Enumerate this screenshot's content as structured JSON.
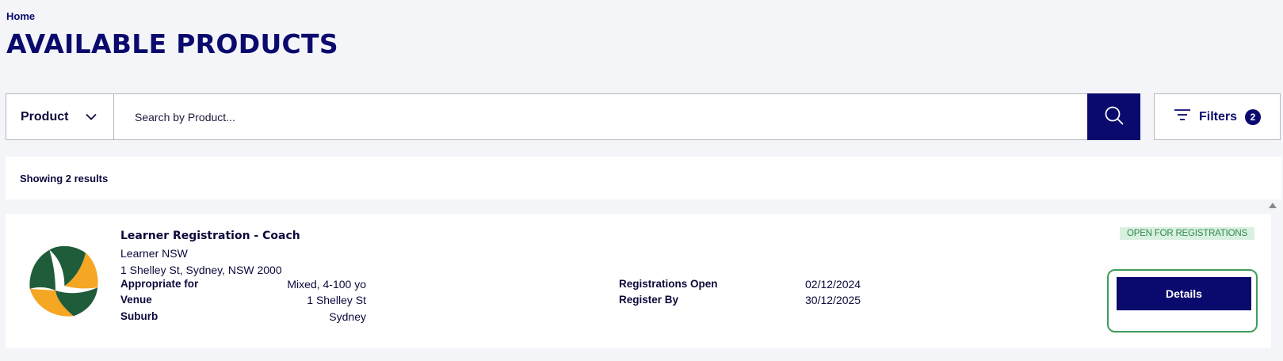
{
  "breadcrumb": "Home",
  "page_title": "AVAILABLE PRODUCTS",
  "search": {
    "type_label": "Product",
    "placeholder": "Search by Product..."
  },
  "filters": {
    "label": "Filters",
    "count": "2"
  },
  "results": {
    "summary": "Showing 2 results"
  },
  "product": {
    "title": "Learner Registration - Coach",
    "org": "Learner NSW",
    "address": "1 Shelley St, Sydney, NSW 2000",
    "status": "OPEN FOR REGISTRATIONS",
    "details_label": "Details",
    "fields": {
      "appropriate_label": "Appropriate for",
      "appropriate_value": "Mixed, 4-100 yo",
      "venue_label": "Venue",
      "venue_value": "1 Shelley St",
      "suburb_label": "Suburb",
      "suburb_value": "Sydney",
      "reg_open_label": "Registrations Open",
      "reg_open_value": "02/12/2024",
      "register_by_label": "Register By",
      "register_by_value": "30/12/2025"
    }
  },
  "colors": {
    "navy": "#0a0a6e",
    "status_green": "#2f8a4e",
    "status_bg": "#d9f0e0",
    "highlight_border": "#3f9d5b",
    "logo_green": "#1f5c3a",
    "logo_yellow": "#f5a623"
  }
}
